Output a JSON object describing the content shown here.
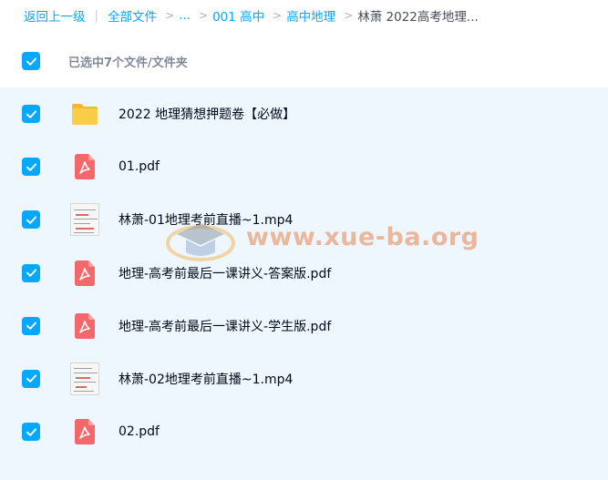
{
  "breadcrumb": {
    "back": "返回上一级",
    "separator": "|",
    "items": [
      "全部文件",
      "...",
      "001 高中",
      "高中地理"
    ],
    "current": "林萧 2022高考地理..."
  },
  "selection": {
    "count_label": "已选中7个文件/文件夹",
    "all_checked": true
  },
  "files": [
    {
      "name": "2022 地理猜想押题卷【必做】",
      "type": "folder",
      "checked": true
    },
    {
      "name": "01.pdf",
      "type": "pdf",
      "checked": true
    },
    {
      "name": "林萧-01地理考前直播~1.mp4",
      "type": "video",
      "checked": true
    },
    {
      "name": "地理-高考前最后一课讲义-答案版.pdf",
      "type": "pdf",
      "checked": true
    },
    {
      "name": "地理-高考前最后一课讲义-学生版.pdf",
      "type": "pdf",
      "checked": true
    },
    {
      "name": "林萧-02地理考前直播~1.mp4",
      "type": "video",
      "checked": true
    },
    {
      "name": "02.pdf",
      "type": "pdf",
      "checked": true
    }
  ],
  "watermark": {
    "text": "www.xue-ba.org"
  },
  "colors": {
    "accent": "#06a7ff",
    "list_bg": "#eef7fe",
    "folder": "#f9c23c",
    "pdf": "#f4676b"
  }
}
